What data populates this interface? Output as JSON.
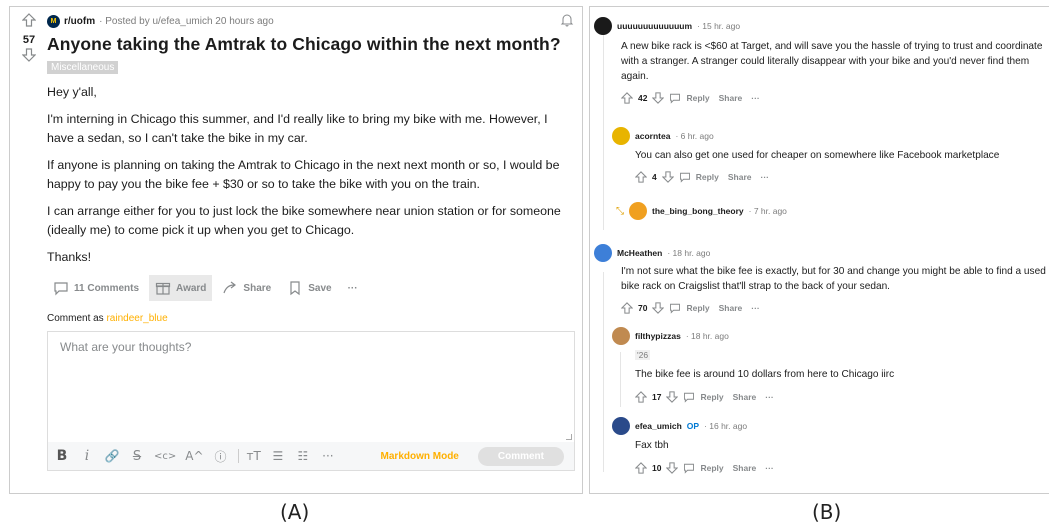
{
  "post": {
    "votes": "57",
    "subreddit": "r/uofm",
    "subreddit_icon": "M",
    "posted_by": "· Posted by u/efea_umich 20 hours ago",
    "title": "Anyone taking the Amtrak to Chicago within the next month?",
    "flair": "Miscellaneous",
    "body": [
      "Hey y'all,",
      "I'm interning in Chicago this summer, and I'd really like to bring my bike with me. However, I have a sedan, so I can't take the bike in my car.",
      "If anyone is planning on taking the Amtrak to Chicago in the next next month or so, I would be happy to pay you the bike fee + $30 or so to take the bike with you on the train.",
      "I can arrange either for you to just lock the bike somewhere near union station or for someone (ideally me) to come pick it up when you get to Chicago.",
      "Thanks!"
    ],
    "actions": {
      "comments": "11 Comments",
      "award": "Award",
      "share": "Share",
      "save": "Save",
      "more": "···"
    }
  },
  "composer": {
    "comment_as": "Comment as",
    "username": "raindeer_blue",
    "placeholder": "What are your thoughts?",
    "toolbar": [
      "B",
      "i",
      "🔗",
      "S",
      "<c>",
      "A^",
      "ⓘ",
      "тT",
      "☰",
      "☷",
      "···"
    ],
    "markdown_mode": "Markdown Mode",
    "comment_button": "Comment"
  },
  "comments": [
    {
      "user": "uuuuuuuuuuuuum",
      "time": "· 15 hr. ago",
      "text": "A new bike rack is <$60 at Target, and will save you the hassle of trying to trust and coordinate with a stranger. A stranger could literally disappear with your bike and you'd never find them again.",
      "votes": "42",
      "avatar_color": "#1a1a1a"
    },
    {
      "user": "acorntea",
      "time": "· 6 hr. ago",
      "text": "You can also get one used for cheaper on somewhere like Facebook marketplace",
      "votes": "4",
      "avatar_color": "#e8b400"
    },
    {
      "user": "the_bing_bong_theory",
      "time": "· 7 hr. ago",
      "avatar_color": "#f0a020"
    },
    {
      "user": "McHeathen",
      "time": "· 18 hr. ago",
      "text": "I'm not sure what the bike fee is exactly, but for 30 and change you might be able to find a used bike rack on Craigslist that'll strap to the back of your sedan.",
      "votes": "70",
      "avatar_color": "#3d7fd8"
    },
    {
      "user": "filthypizzas",
      "time": "· 18 hr. ago",
      "flair": "'26",
      "text": "The bike fee is around 10 dollars from here to Chicago iirc",
      "votes": "17",
      "avatar_color": "#c08a50"
    },
    {
      "user": "efea_umich",
      "op": "OP",
      "time": "· 16 hr. ago",
      "text": "Fax tbh",
      "votes": "10",
      "avatar_color": "#2a4a8a"
    }
  ],
  "comment_actions": {
    "reply": "Reply",
    "share": "Share",
    "more": "···"
  },
  "labels": {
    "a": "(A)",
    "b": "(B)"
  }
}
